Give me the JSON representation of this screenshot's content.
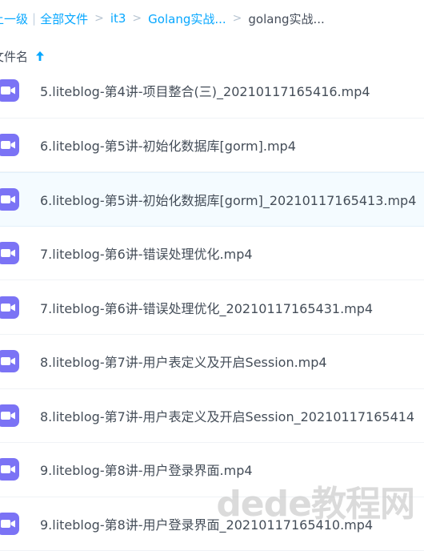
{
  "breadcrumb": {
    "up_label": "上一级",
    "items": [
      "全部文件",
      "it3",
      "Golang实战...",
      "golang实战..."
    ],
    "separator": ">"
  },
  "column_header": {
    "title": "文件名"
  },
  "files": [
    {
      "name": "5.liteblog-第4讲-项目整合(三)_20210117165416.mp4",
      "icon": "video-file-icon"
    },
    {
      "name": "6.liteblog-第5讲-初始化数据库[gorm].mp4",
      "icon": "video-file-icon"
    },
    {
      "name": "6.liteblog-第5讲-初始化数据库[gorm]_20210117165413.mp4",
      "icon": "video-file-icon",
      "selected": true
    },
    {
      "name": "7.liteblog-第6讲-错误处理优化.mp4",
      "icon": "video-file-icon"
    },
    {
      "name": "7.liteblog-第6讲-错误处理优化_20210117165431.mp4",
      "icon": "video-file-icon"
    },
    {
      "name": "8.liteblog-第7讲-用户表定义及开启Session.mp4",
      "icon": "video-file-icon"
    },
    {
      "name": "8.liteblog-第7讲-用户表定义及开启Session_20210117165414",
      "icon": "video-file-icon"
    },
    {
      "name": "9.liteblog-第8讲-用户登录界面.mp4",
      "icon": "video-file-icon"
    },
    {
      "name": "9.liteblog-第8讲-用户登录界面_20210117165410.mp4",
      "icon": "video-file-icon"
    }
  ],
  "watermark": "dede教程网",
  "colors": {
    "accent": "#06a7ff",
    "video_icon": "#7b73f5",
    "text": "#444d58"
  }
}
